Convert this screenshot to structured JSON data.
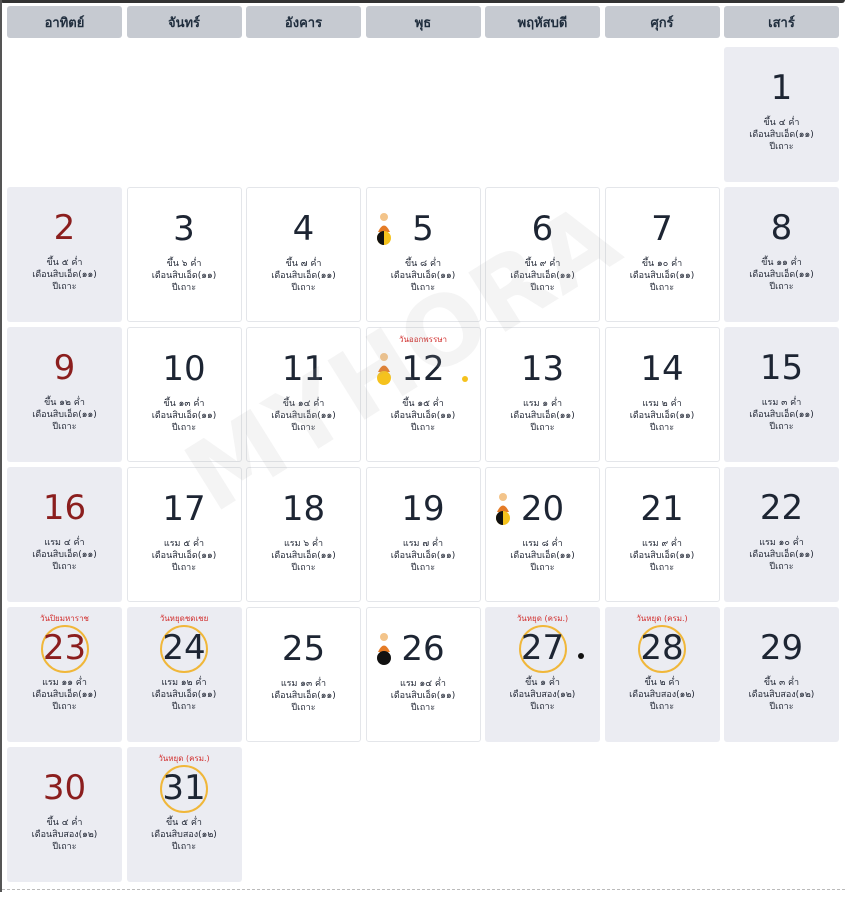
{
  "weekdays": [
    "อาทิตย์",
    "จันทร์",
    "อังคาร",
    "พุธ",
    "พฤหัสบดี",
    "ศุกร์",
    "เสาร์"
  ],
  "watermark": "MYHORA",
  "colors": {
    "header_bg": "#c6cad1",
    "weekend_bg": "#ebecf2",
    "holiday_text": "#d2302f",
    "sunday_number": "#8b1e1e",
    "ring": "#f0b73a"
  },
  "days": [
    {
      "day": "1",
      "col": 7,
      "shaded": true,
      "lunar": "ขึ้น ๔ ค่ำ",
      "month": "เดือนสิบเอ็ด(๑๑)",
      "year": "ปีเถาะ"
    },
    {
      "day": "2",
      "col": 1,
      "shaded": true,
      "red": true,
      "lunar": "ขึ้น ๕ ค่ำ",
      "month": "เดือนสิบเอ็ด(๑๑)",
      "year": "ปีเถาะ"
    },
    {
      "day": "3",
      "lunar": "ขึ้น ๖ ค่ำ",
      "month": "เดือนสิบเอ็ด(๑๑)",
      "year": "ปีเถาะ"
    },
    {
      "day": "4",
      "lunar": "ขึ้น ๗ ค่ำ",
      "month": "เดือนสิบเอ็ด(๑๑)",
      "year": "ปีเถาะ"
    },
    {
      "day": "5",
      "lunar": "ขึ้น ๘ ค่ำ",
      "month": "เดือนสิบเอ็ด(๑๑)",
      "year": "ปีเถาะ",
      "icon": "monk-half-moon-icon"
    },
    {
      "day": "6",
      "lunar": "ขึ้น ๙ ค่ำ",
      "month": "เดือนสิบเอ็ด(๑๑)",
      "year": "ปีเถาะ"
    },
    {
      "day": "7",
      "lunar": "ขึ้น ๑๐ ค่ำ",
      "month": "เดือนสิบเอ็ด(๑๑)",
      "year": "ปีเถาะ"
    },
    {
      "day": "8",
      "shaded": true,
      "lunar": "ขึ้น ๑๑ ค่ำ",
      "month": "เดือนสิบเอ็ด(๑๑)",
      "year": "ปีเถาะ"
    },
    {
      "day": "9",
      "shaded": true,
      "red": true,
      "lunar": "ขึ้น ๑๒ ค่ำ",
      "month": "เดือนสิบเอ็ด(๑๑)",
      "year": "ปีเถาะ"
    },
    {
      "day": "10",
      "lunar": "ขึ้น ๑๓ ค่ำ",
      "month": "เดือนสิบเอ็ด(๑๑)",
      "year": "ปีเถาะ"
    },
    {
      "day": "11",
      "lunar": "ขึ้น ๑๔ ค่ำ",
      "month": "เดือนสิบเอ็ด(๑๑)",
      "year": "ปีเถาะ"
    },
    {
      "day": "12",
      "lunar": "ขึ้น ๑๕ ค่ำ",
      "month": "เดือนสิบเอ็ด(๑๑)",
      "year": "ปีเถาะ",
      "holiday": "วันออกพรรษา",
      "icon": "monk-full-moon-icon",
      "dot": "yellow"
    },
    {
      "day": "13",
      "lunar": "แรม ๑ ค่ำ",
      "month": "เดือนสิบเอ็ด(๑๑)",
      "year": "ปีเถาะ"
    },
    {
      "day": "14",
      "lunar": "แรม ๒ ค่ำ",
      "month": "เดือนสิบเอ็ด(๑๑)",
      "year": "ปีเถาะ"
    },
    {
      "day": "15",
      "shaded": true,
      "lunar": "แรม ๓ ค่ำ",
      "month": "เดือนสิบเอ็ด(๑๑)",
      "year": "ปีเถาะ"
    },
    {
      "day": "16",
      "shaded": true,
      "red": true,
      "lunar": "แรม ๔ ค่ำ",
      "month": "เดือนสิบเอ็ด(๑๑)",
      "year": "ปีเถาะ"
    },
    {
      "day": "17",
      "lunar": "แรม ๕ ค่ำ",
      "month": "เดือนสิบเอ็ด(๑๑)",
      "year": "ปีเถาะ"
    },
    {
      "day": "18",
      "lunar": "แรม ๖ ค่ำ",
      "month": "เดือนสิบเอ็ด(๑๑)",
      "year": "ปีเถาะ"
    },
    {
      "day": "19",
      "lunar": "แรม ๗ ค่ำ",
      "month": "เดือนสิบเอ็ด(๑๑)",
      "year": "ปีเถาะ"
    },
    {
      "day": "20",
      "lunar": "แรม ๘ ค่ำ",
      "month": "เดือนสิบเอ็ด(๑๑)",
      "year": "ปีเถาะ",
      "icon": "monk-half-moon-icon"
    },
    {
      "day": "21",
      "lunar": "แรม ๙ ค่ำ",
      "month": "เดือนสิบเอ็ด(๑๑)",
      "year": "ปีเถาะ"
    },
    {
      "day": "22",
      "shaded": true,
      "lunar": "แรม ๑๐ ค่ำ",
      "month": "เดือนสิบเอ็ด(๑๑)",
      "year": "ปีเถาะ"
    },
    {
      "day": "23",
      "shaded": true,
      "red": true,
      "ring": true,
      "holiday": "วันปิยมหาราช",
      "lunar": "แรม ๑๑ ค่ำ",
      "month": "เดือนสิบเอ็ด(๑๑)",
      "year": "ปีเถาะ"
    },
    {
      "day": "24",
      "shaded": true,
      "ring": true,
      "holiday": "วันหยุดชดเชย",
      "lunar": "แรม ๑๒ ค่ำ",
      "month": "เดือนสิบเอ็ด(๑๑)",
      "year": "ปีเถาะ"
    },
    {
      "day": "25",
      "lunar": "แรม ๑๓ ค่ำ",
      "month": "เดือนสิบเอ็ด(๑๑)",
      "year": "ปีเถาะ"
    },
    {
      "day": "26",
      "lunar": "แรม ๑๔ ค่ำ",
      "month": "เดือนสิบเอ็ด(๑๑)",
      "year": "ปีเถาะ",
      "icon": "monk-new-moon-icon"
    },
    {
      "day": "27",
      "shaded": true,
      "ring": true,
      "holiday": "วันหยุด (ครม.)",
      "lunar": "ขึ้น ๑ ค่ำ",
      "month": "เดือนสิบสอง(๑๒)",
      "year": "ปีเถาะ",
      "dot": "black"
    },
    {
      "day": "28",
      "shaded": true,
      "ring": true,
      "holiday": "วันหยุด (ครม.)",
      "lunar": "ขึ้น ๒ ค่ำ",
      "month": "เดือนสิบสอง(๑๒)",
      "year": "ปีเถาะ"
    },
    {
      "day": "29",
      "shaded": true,
      "lunar": "ขึ้น ๓ ค่ำ",
      "month": "เดือนสิบสอง(๑๒)",
      "year": "ปีเถาะ"
    },
    {
      "day": "30",
      "shaded": true,
      "red": true,
      "lunar": "ขึ้น ๔ ค่ำ",
      "month": "เดือนสิบสอง(๑๒)",
      "year": "ปีเถาะ"
    },
    {
      "day": "31",
      "shaded": true,
      "ring": true,
      "holiday": "วันหยุด (ครม.)",
      "lunar": "ขึ้น ๕ ค่ำ",
      "month": "เดือนสิบสอง(๑๒)",
      "year": "ปีเถาะ"
    }
  ]
}
